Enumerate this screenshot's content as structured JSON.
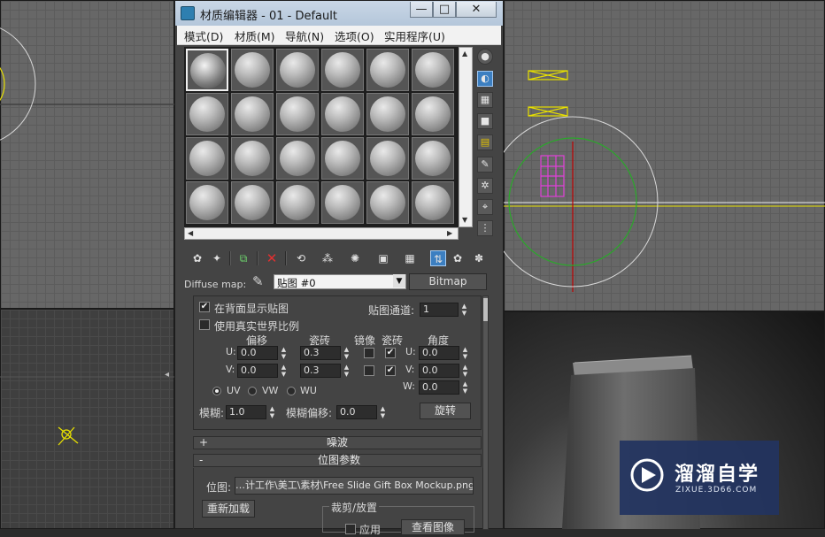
{
  "window": {
    "title": "材质编辑器 - 01 - Default",
    "minimize_label": "—",
    "maximize_label": "□",
    "close_label": "✕"
  },
  "menu": {
    "items": [
      "模式(D)",
      "材质(M)",
      "导航(N)",
      "选项(O)",
      "实用程序(U)"
    ]
  },
  "slots": {
    "rows": 4,
    "cols": 6,
    "active_index": 0
  },
  "side_icons": [
    "sample-type-icon",
    "backlight-icon",
    "background-checker-icon",
    "sample-uv-tiling-icon",
    "video-color-check-icon",
    "make-preview-icon",
    "options-icon",
    "select-by-material-icon",
    "material-map-navigator-icon"
  ],
  "toolbar_icons": [
    "get-material-icon",
    "put-to-scene-icon",
    "assign-to-selection-icon",
    "reset-map-icon",
    "make-unique-icon",
    "put-to-library-icon",
    "material-id-channel-icon",
    "show-shaded-icon",
    "show-end-result-icon",
    "go-to-parent-icon",
    "go-forward-icon"
  ],
  "map_row": {
    "label": "Diffuse map:",
    "map_name": "贴图 #0",
    "map_type": "Bitmap"
  },
  "coordinates": {
    "show_map_on_back": "在背面显示贴图",
    "show_map_on_back_checked": true,
    "real_world_scale": "使用真实世界比例",
    "real_world_scale_checked": false,
    "map_channel_label": "贴图通道:",
    "map_channel_value": "1",
    "headers": {
      "offset": "偏移",
      "tiling": "瓷砖",
      "mirror": "镜像",
      "tile": "瓷砖",
      "angle": "角度"
    },
    "u_label": "U:",
    "v_label": "V:",
    "w_label": "W:",
    "u_offset": "0.0",
    "v_offset": "0.0",
    "u_tiling": "0.3",
    "v_tiling": "0.3",
    "u_mirror": false,
    "v_mirror": false,
    "u_tile": true,
    "v_tile": true,
    "u_angle": "0.0",
    "v_angle": "0.0",
    "w_angle": "0.0",
    "uv": "UV",
    "vw": "VW",
    "wu": "WU",
    "blur_label": "模糊:",
    "blur_value": "1.0",
    "blur_offset_label": "模糊偏移:",
    "blur_offset_value": "0.0",
    "rotate_label": "旋转"
  },
  "rollouts": {
    "noise": {
      "sign": "+",
      "title": "噪波"
    },
    "bitmap_params": {
      "sign": "-",
      "title": "位图参数"
    }
  },
  "bitmap": {
    "path_label": "位图:",
    "path_value": "…计工作\\美工\\素材\\Free Slide Gift Box Mockup.png",
    "reload_label": "重新加载",
    "crop_group_label": "裁剪/放置",
    "apply_label": "应用",
    "view_image_label": "查看图像"
  },
  "watermark": {
    "brand": "溜溜自学",
    "url": "ZIXUE.3D66.COM"
  },
  "colors": {
    "selection_yellow": "#e8e000",
    "object_magenta": "#e040d8",
    "circle_green": "#2aa82a",
    "accent_blue": "#3c7fc1"
  }
}
